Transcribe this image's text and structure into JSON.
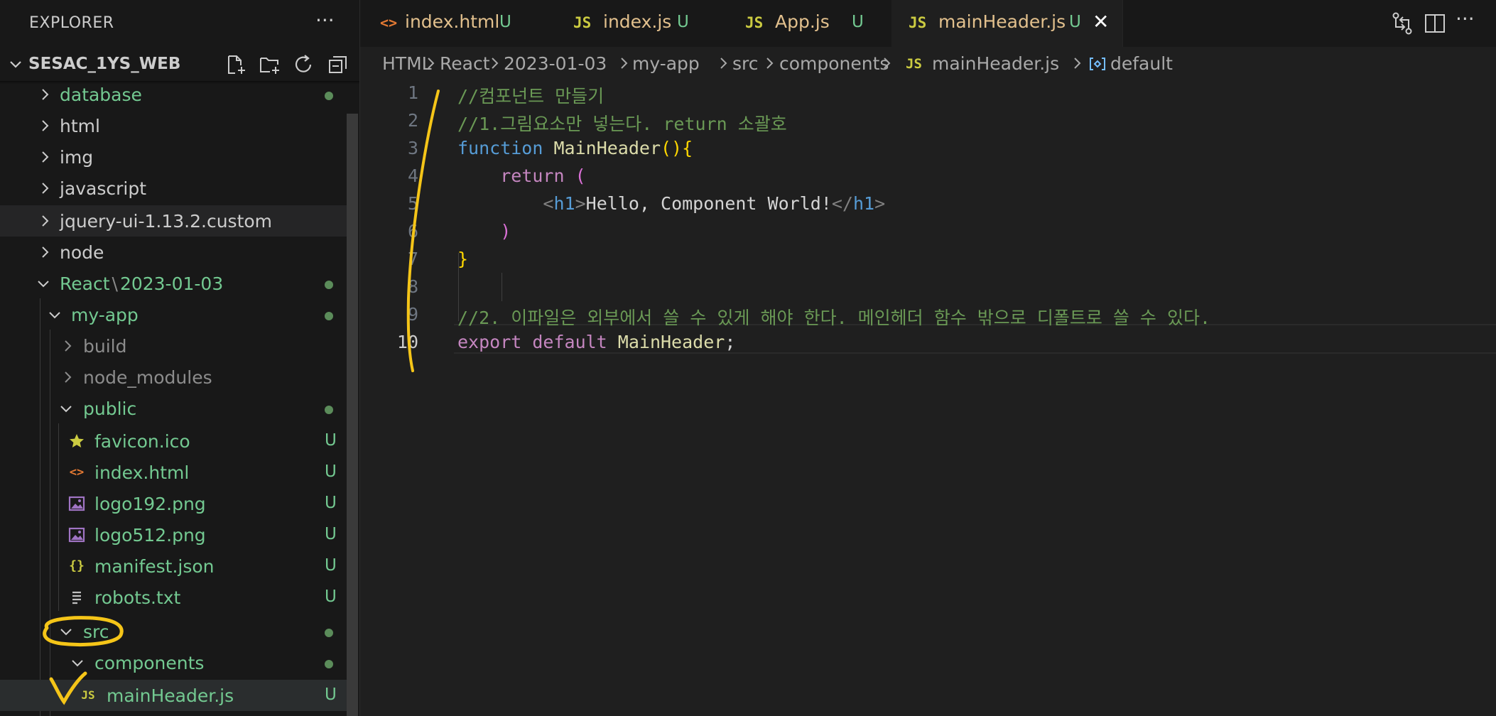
{
  "sidebar": {
    "title": "EXPLORER",
    "more": "···",
    "workspace": "SESAC_1YS_WEB",
    "tree": [
      {
        "label": "database",
        "status": "dot"
      },
      {
        "label": "html",
        "status": ""
      },
      {
        "label": "img",
        "status": ""
      },
      {
        "label": "javascript",
        "status": ""
      },
      {
        "label": "jquery-ui-1.13.2.custom",
        "status": ""
      },
      {
        "label": "node",
        "status": ""
      },
      {
        "label": "React",
        "label2": "2023-01-03",
        "status": "dot"
      },
      {
        "label": "my-app",
        "status": "dot"
      },
      {
        "label": "build",
        "status": ""
      },
      {
        "label": "node_modules",
        "status": ""
      },
      {
        "label": "public",
        "status": "dot"
      },
      {
        "label": "favicon.ico",
        "status": "U"
      },
      {
        "label": "index.html",
        "status": "U"
      },
      {
        "label": "logo192.png",
        "status": "U"
      },
      {
        "label": "logo512.png",
        "status": "U"
      },
      {
        "label": "manifest.json",
        "status": "U"
      },
      {
        "label": "robots.txt",
        "status": "U"
      },
      {
        "label": "src",
        "status": "dot"
      },
      {
        "label": "components",
        "status": "dot"
      },
      {
        "label": "mainHeader.js",
        "status": "U"
      }
    ]
  },
  "tabs": [
    {
      "label": "index.html",
      "mod": "U",
      "icon": "<>"
    },
    {
      "label": "index.js",
      "mod": "U",
      "icon": "JS"
    },
    {
      "label": "App.js",
      "mod": "U",
      "icon": "JS"
    },
    {
      "label": "mainHeader.js",
      "mod": "U",
      "icon": "JS",
      "close": "✕"
    }
  ],
  "breadcrumb": [
    "HTML",
    "React",
    "2023-01-03",
    "my-app",
    "src",
    "components",
    "mainHeader.js",
    "default"
  ],
  "editor": {
    "line_numbers": [
      "1",
      "2",
      "3",
      "4",
      "5",
      "6",
      "7",
      "8",
      "9",
      "10"
    ],
    "line1": "//컴포넌트 만들기",
    "line2": "//1.그림요소만 넣는다. return 소괄호",
    "line3": {
      "kw": "function",
      "fn": "MainHeader",
      "paren": "()",
      "brace": "{"
    },
    "line4": {
      "kw": "return",
      "paren": "("
    },
    "line5": {
      "open_lt": "<",
      "open_tag": "h1",
      "open_gt": ">",
      "text": "Hello, Component World!",
      "close_lt": "</",
      "close_tag": "h1",
      "close_gt": ">"
    },
    "line6": ")",
    "line7": "}",
    "line9": "//2. 이파일은 외부에서 쓸 수 있게 해야 한다. 메인헤더 함수 밖으로 디폴트로 쓸 수 있다.",
    "line10": {
      "kw1": "export",
      "kw2": "default",
      "name": "MainHeader",
      "semi": ";"
    }
  },
  "colors": {
    "modified": "#73c991",
    "folder_text": "#73c991",
    "js_icon": "#cbcb41",
    "html_icon": "#e37933",
    "annotation": "#f5c518"
  }
}
